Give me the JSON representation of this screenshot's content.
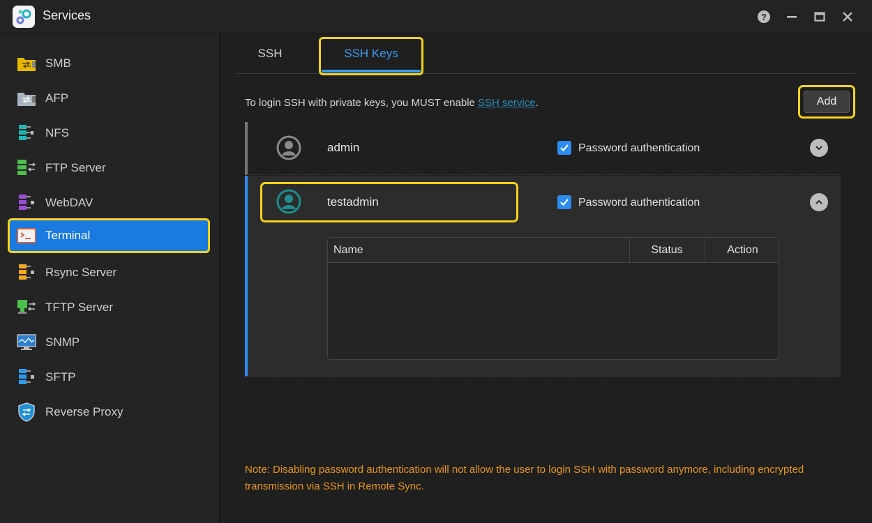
{
  "window": {
    "title": "Services"
  },
  "sidebar": {
    "items": [
      {
        "label": "SMB",
        "icon": "smb-folder-icon"
      },
      {
        "label": "AFP",
        "icon": "afp-folder-icon"
      },
      {
        "label": "NFS",
        "icon": "nfs-server-icon"
      },
      {
        "label": "FTP Server",
        "icon": "ftp-server-icon"
      },
      {
        "label": "WebDAV",
        "icon": "webdav-icon"
      },
      {
        "label": "Terminal",
        "icon": "terminal-icon",
        "active": true
      },
      {
        "label": "Rsync Server",
        "icon": "rsync-server-icon"
      },
      {
        "label": "TFTP Server",
        "icon": "tftp-server-icon"
      },
      {
        "label": "SNMP",
        "icon": "snmp-monitor-icon"
      },
      {
        "label": "SFTP",
        "icon": "sftp-server-icon"
      },
      {
        "label": "Reverse Proxy",
        "icon": "shield-icon"
      }
    ]
  },
  "tabs": [
    {
      "label": "SSH"
    },
    {
      "label": "SSH Keys",
      "active": true
    }
  ],
  "info": {
    "prefix": "To login SSH with private keys, you MUST enable ",
    "link": "SSH service",
    "suffix": "."
  },
  "add_button": "Add",
  "users": [
    {
      "name": "admin",
      "password_auth_label": "Password authentication",
      "password_auth": true,
      "expanded": false
    },
    {
      "name": "testadmin",
      "password_auth_label": "Password authentication",
      "password_auth": true,
      "expanded": true
    }
  ],
  "key_table": {
    "columns": [
      "Name",
      "Status",
      "Action"
    ],
    "rows": []
  },
  "note": "Note: Disabling password authentication will not allow the user to login SSH with password anymore, including encrypted transmission via SSH in Remote Sync.",
  "colors": {
    "accent": "#2d8cf0",
    "highlight": "#f7d21a",
    "note": "#e8951e",
    "teal_avatar": "#1e8e8e"
  }
}
